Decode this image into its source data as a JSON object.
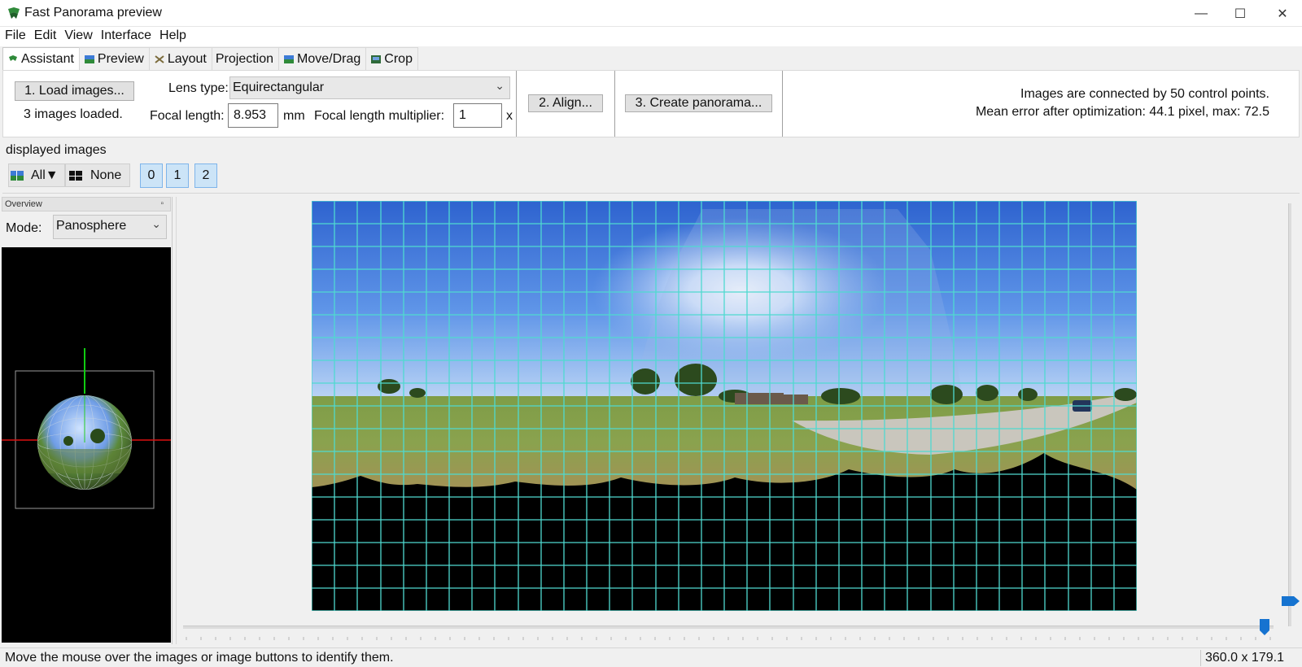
{
  "window": {
    "title": "Fast Panorama preview",
    "minimize": "—",
    "maximize": "☐",
    "close": "✕"
  },
  "menu": [
    "File",
    "Edit",
    "View",
    "Interface",
    "Help"
  ],
  "tabs": [
    {
      "label": "Assistant",
      "active": true
    },
    {
      "label": "Preview",
      "active": false
    },
    {
      "label": "Layout",
      "active": false
    },
    {
      "label": "Projection",
      "active": false
    },
    {
      "label": "Move/Drag",
      "active": false
    },
    {
      "label": "Crop",
      "active": false
    }
  ],
  "assistant": {
    "load_button": "1. Load images...",
    "images_loaded": "3 images loaded.",
    "lens_type_label": "Lens type:",
    "lens_type_value": "Equirectangular",
    "focal_length_label": "Focal length:",
    "focal_length_value": "8.953",
    "focal_length_unit": "mm",
    "multiplier_label": "Focal length multiplier:",
    "multiplier_value": "1",
    "multiplier_unit": "x",
    "align_button": "2. Align...",
    "create_button": "3. Create panorama...",
    "info_line1": "Images are connected by 50 control points.",
    "info_line2": "Mean error after optimization: 44.1 pixel, max: 72.5"
  },
  "displayed_images": {
    "label": "displayed images",
    "all_button": "All▼",
    "none_button": "None",
    "image_buttons": [
      "0",
      "1",
      "2"
    ]
  },
  "overview": {
    "header": "Overview",
    "pin": "▫",
    "mode_label": "Mode:",
    "mode_value": "Panosphere"
  },
  "colors": {
    "grid": "#4fd9d0",
    "sky_top": "#3f74d8",
    "grass": "#7e9b45",
    "slider": "#1673d0"
  },
  "status": {
    "message": "Move the mouse over the images or image buttons to identify them.",
    "fov": "360.0 x 179.1"
  }
}
